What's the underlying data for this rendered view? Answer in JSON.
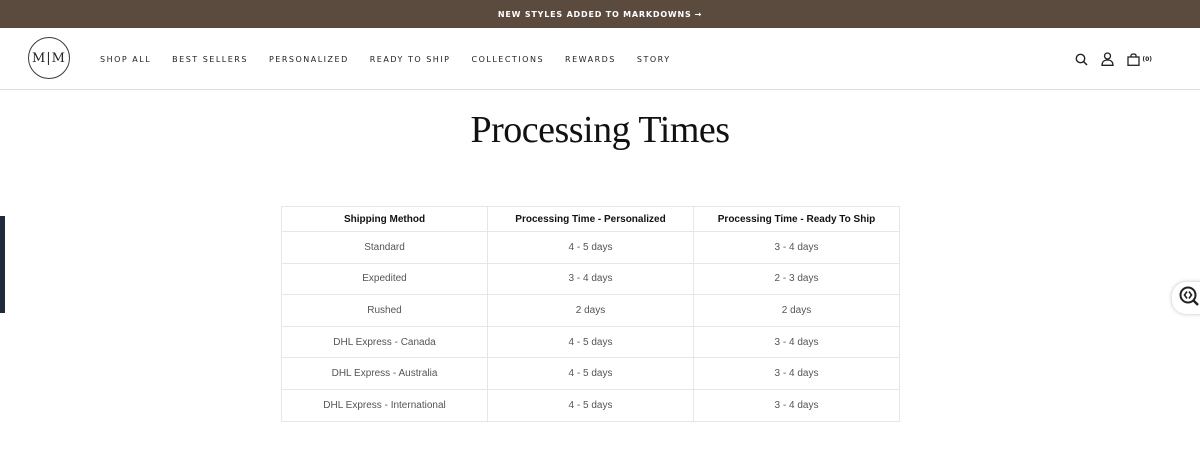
{
  "announcement": {
    "text": "NEW STYLES ADDED TO MARKDOWNS",
    "arrow": "→"
  },
  "logo": {
    "text": "M|M"
  },
  "nav": {
    "items": [
      "SHOP ALL",
      "BEST SELLERS",
      "PERSONALIZED",
      "READY TO SHIP",
      "COLLECTIONS",
      "REWARDS",
      "STORY"
    ]
  },
  "header_icons": {
    "search": "search-icon",
    "account": "user-icon",
    "cart": "bag-icon",
    "cart_count": "(0)"
  },
  "page": {
    "title": "Processing Times"
  },
  "table": {
    "headers": [
      "Shipping Method",
      "Processing Time - Personalized",
      "Processing Time - Ready To Ship"
    ],
    "rows": [
      [
        "Standard",
        "4 - 5 days",
        "3 - 4 days"
      ],
      [
        "Expedited",
        "3 - 4 days",
        "2 - 3 days"
      ],
      [
        "Rushed",
        "2 days",
        "2 days"
      ],
      [
        "DHL Express - Canada",
        "4 - 5 days",
        "3 - 4 days"
      ],
      [
        "DHL Express - Australia",
        "4 - 5 days",
        "3 - 4 days"
      ],
      [
        "DHL Express - International",
        "4 - 5 days",
        "3 - 4 days"
      ]
    ]
  },
  "colors": {
    "announcement_bg": "#5b4a3e",
    "side_tab": "#1f2a3d"
  },
  "accessibility_widget": {
    "icon": "accessibility-icon"
  }
}
